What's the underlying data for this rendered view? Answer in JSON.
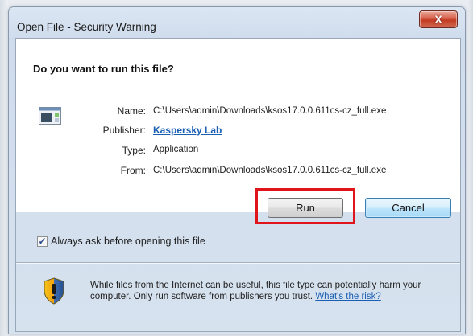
{
  "window": {
    "title": "Open File - Security Warning",
    "close_label": "X"
  },
  "dialog": {
    "question": "Do you want to run this file?",
    "fields": {
      "name_label": "Name:",
      "name_value": "C:\\Users\\admin\\Downloads\\ksos17.0.0.611cs-cz_full.exe",
      "publisher_label": "Publisher:",
      "publisher_value": "Kaspersky Lab",
      "type_label": "Type:",
      "type_value": "Application",
      "from_label": "From:",
      "from_value": "C:\\Users\\admin\\Downloads\\ksos17.0.0.611cs-cz_full.exe"
    },
    "buttons": {
      "run": "Run",
      "cancel": "Cancel"
    },
    "checkbox": {
      "label": "Always ask before opening this file",
      "checked": true
    },
    "warning": {
      "text": "While files from the Internet can be useful, this file type can potentially harm your computer. Only run software from publishers you trust. ",
      "link": "What's the risk?"
    }
  },
  "colors": {
    "highlight": "#e0151c",
    "link": "#1a5fb4",
    "close_button": "#c23a22"
  },
  "icons": [
    "close-icon",
    "application-file-icon",
    "check-icon",
    "shield-warning-icon"
  ]
}
